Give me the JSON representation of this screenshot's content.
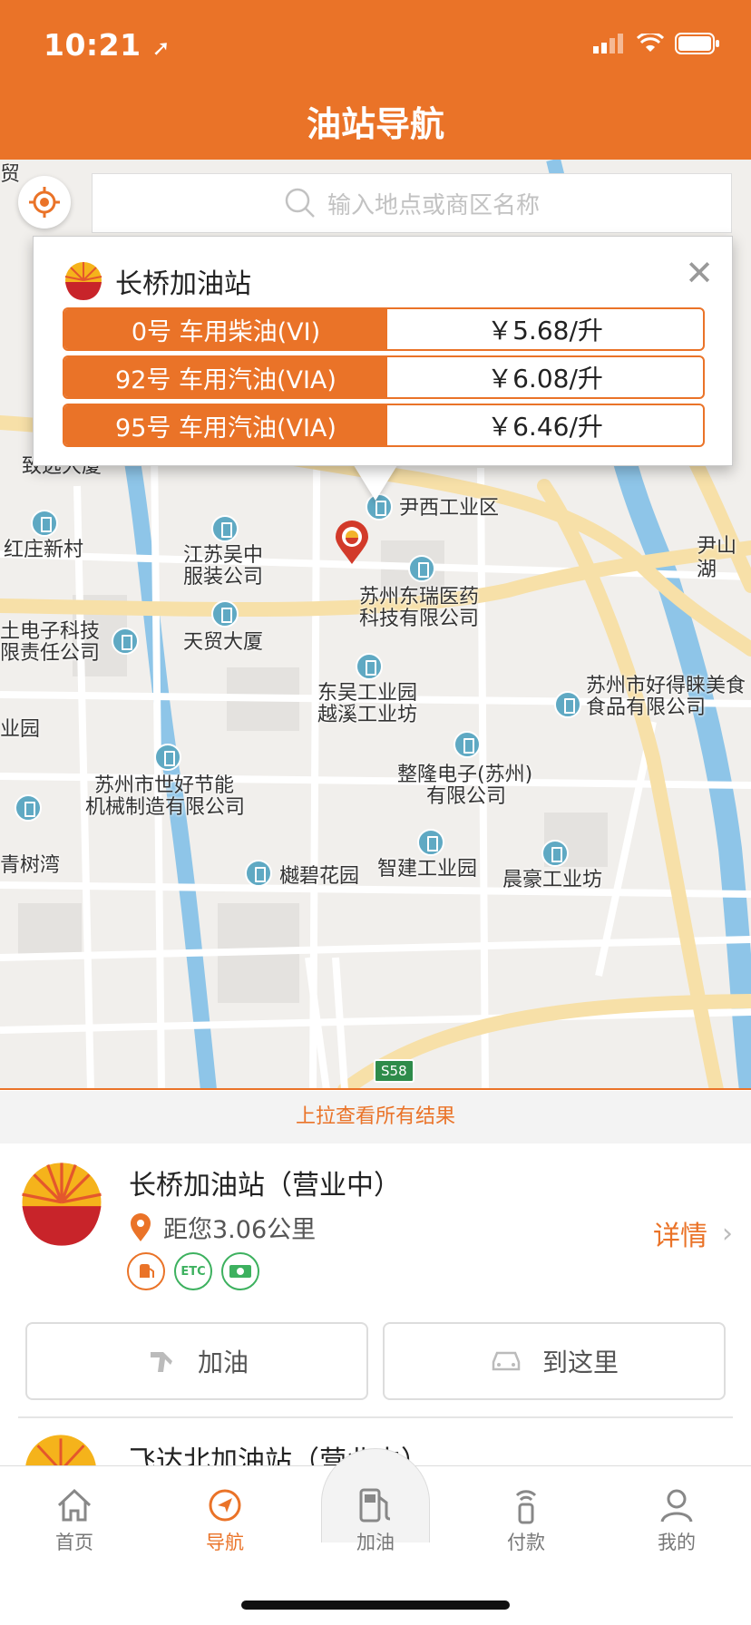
{
  "status_bar": {
    "time": "10:21"
  },
  "header": {
    "title": "油站导航"
  },
  "search": {
    "placeholder": "输入地点或商区名称"
  },
  "popup": {
    "station_name": "长桥加油站",
    "prices": [
      {
        "fuel": "0号 车用柴油(VI)",
        "price": "￥5.68/升"
      },
      {
        "fuel": "92号 车用汽油(VIA)",
        "price": "￥6.08/升"
      },
      {
        "fuel": "95号 车用汽油(VIA)",
        "price": "￥6.46/升"
      }
    ]
  },
  "map_labels": {
    "zhiyuan": "致远大厦",
    "hongzhuang": "红庄新村",
    "wuzhong_1": "江苏吴中",
    "wuzhong_2": "服装公司",
    "yinxi": "尹西工业区",
    "yinshan": "尹山湖",
    "dongrui_1": "苏州东瑞医药",
    "dongrui_2": "科技有限公司",
    "dianzi_1": "土电子科技",
    "dianzi_2": "限责任公司",
    "tianmao": "天贸大厦",
    "dongwu_1": "东吴工业园",
    "dongwu_2": "越溪工业坊",
    "haodelai_1": "苏州市好得睐美食",
    "haodelai_2": "食品有限公司",
    "yuan_left": "业园",
    "shihao_1": "苏州市世好节能",
    "shihao_2": "机械制造有限公司",
    "zhenglong_1": "整隆电子(苏州)",
    "zhenglong_2": "有限公司",
    "qingshuwan": "青树湾",
    "shubi": "樾碧花园",
    "zhijian": "智建工业园",
    "chenhao": "晨豪工业坊",
    "road_s58": "S58",
    "mao_left": "贸"
  },
  "pullup_text": "上拉查看所有结果",
  "station_card": {
    "name": "长桥加油站（营业中）",
    "distance": "距您3.06公里",
    "detail_label": "详情",
    "tags": [
      "fuel-service-icon",
      "ETC",
      "cash-pay-icon"
    ],
    "tag_etc": "ETC",
    "refuel_label": "加油",
    "navigate_label": "到这里",
    "next_station_name": "飞达北加油站（营业中）"
  },
  "tabbar": {
    "tabs": [
      {
        "label": "首页",
        "icon": "home-icon"
      },
      {
        "label": "导航",
        "icon": "navigation-icon"
      },
      {
        "label": "加油",
        "icon": "fuel-pump-icon"
      },
      {
        "label": "付款",
        "icon": "contactless-pay-icon"
      },
      {
        "label": "我的",
        "icon": "profile-icon"
      }
    ],
    "active": "导航"
  },
  "colors": {
    "accent": "#ea7328",
    "green": "#3db15f",
    "poi": "#5fa9c3",
    "water": "#8ec5e8",
    "road_major": "#f7e0a8"
  }
}
